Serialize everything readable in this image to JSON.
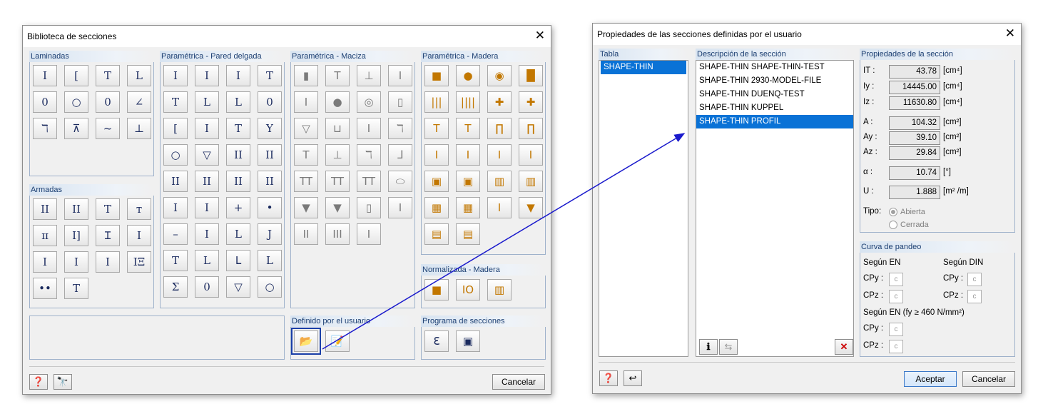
{
  "left_dialog": {
    "title": "Biblioteca de secciones",
    "close_glyph": "✕",
    "cancel_label": "Cancelar",
    "groups": {
      "laminadas": "Laminadas",
      "armadas": "Armadas",
      "pared_delgada": "Paramétrica - Pared delgada",
      "maciza": "Paramétrica - Maciza",
      "madera": "Paramétrica - Madera",
      "normalizada": "Normalizada - Madera",
      "definido": "Definido por el usuario",
      "programa": "Programa de secciones"
    },
    "icons": {
      "laminadas": [
        "I",
        "[",
        "T",
        "L",
        "0",
        "○",
        "0",
        "∠",
        "ℸ",
        "⊼",
        "~",
        "⊥"
      ],
      "armadas": [
        "II",
        "II",
        "T",
        "ᴛ",
        "ɪɪ",
        "I]",
        "Ɪ",
        "I",
        "I",
        "I",
        "I",
        "IΞ",
        "••",
        "T"
      ],
      "pared_delgada": [
        "I",
        "I",
        "I",
        "T",
        "T",
        "L",
        "L",
        "0",
        "[",
        "I",
        "T",
        "Y",
        "○",
        "▽",
        "II",
        "II",
        "II",
        "II",
        "II",
        "II",
        "I",
        "I",
        "+",
        "•",
        "–",
        "I",
        "L",
        "J",
        "T",
        "L",
        "ᒪ",
        "L",
        "Σ",
        "0",
        "▽",
        "○"
      ],
      "maciza": [
        "▮",
        "T",
        "⊥",
        "I",
        "I",
        "●",
        "◎",
        "▯",
        "▽",
        "⊔",
        "I",
        "ℸ",
        "T",
        "⊥",
        "ℸ",
        "ᒧ",
        "TT",
        "TT",
        "TT",
        "⬭",
        "▼",
        "▼",
        "▯",
        "I",
        "II",
        "III",
        "I"
      ],
      "madera": [
        "■",
        "●",
        "◉",
        "▐▌",
        "|||",
        "||||",
        "✚",
        "✚",
        "T",
        "T",
        "∏",
        "∏",
        "I",
        "I",
        "I",
        "I",
        "▣",
        "▣",
        "▥",
        "▥",
        "▦",
        "▦",
        "I",
        "▼",
        "▤",
        "▤"
      ],
      "normalizada": [
        "■",
        "IO",
        "▥"
      ],
      "definido": [
        "📂",
        "📝"
      ],
      "programa": [
        "ℇ",
        "▣"
      ]
    }
  },
  "right_dialog": {
    "title": "Propiedades de las secciones definidas por el usuario",
    "close_glyph": "✕",
    "table_header": "Tabla",
    "table_items": [
      "SHAPE-THIN"
    ],
    "desc_header": "Descripción de la sección",
    "desc_items": [
      "SHAPE-THIN SHAPE-THIN-TEST",
      "SHAPE-THIN 2930-MODEL-FILE",
      "SHAPE-THIN DUENQ-TEST",
      "SHAPE-THIN KUPPEL",
      "SHAPE-THIN PROFIL"
    ],
    "selected_desc_index": 4,
    "props_header": "Propiedades de la sección",
    "props": [
      {
        "label": "IT :",
        "value": "43.78",
        "unit": "[cm⁴]"
      },
      {
        "label": "Iy :",
        "value": "14445.00",
        "unit": "[cm⁴]"
      },
      {
        "label": "Iz :",
        "value": "11630.80",
        "unit": "[cm⁴]"
      },
      {
        "label": "A :",
        "value": "104.32",
        "unit": "[cm²]"
      },
      {
        "label": "Ay :",
        "value": "39.10",
        "unit": "[cm²]"
      },
      {
        "label": "Az :",
        "value": "29.84",
        "unit": "[cm²]"
      },
      {
        "label": "α :",
        "value": "10.74",
        "unit": "[°]"
      },
      {
        "label": "U :",
        "value": "1.888",
        "unit": "[m² /m]"
      }
    ],
    "tipo_label": "Tipo:",
    "tipo_options": [
      "Abierta",
      "Cerrada"
    ],
    "pandeo_header": "Curva de pandeo",
    "segun_en": "Según EN",
    "segun_din": "Según DIN",
    "cpy": "CPy :",
    "cpz": "CPz :",
    "curve_value": "c",
    "segun_en_fy": "Según EN (fy ≥ 460 N/mm²)",
    "aceptar_label": "Aceptar",
    "cancelar_label": "Cancelar"
  },
  "colors": {
    "connector": "#1a1acc",
    "accent": "#0a72d6"
  }
}
